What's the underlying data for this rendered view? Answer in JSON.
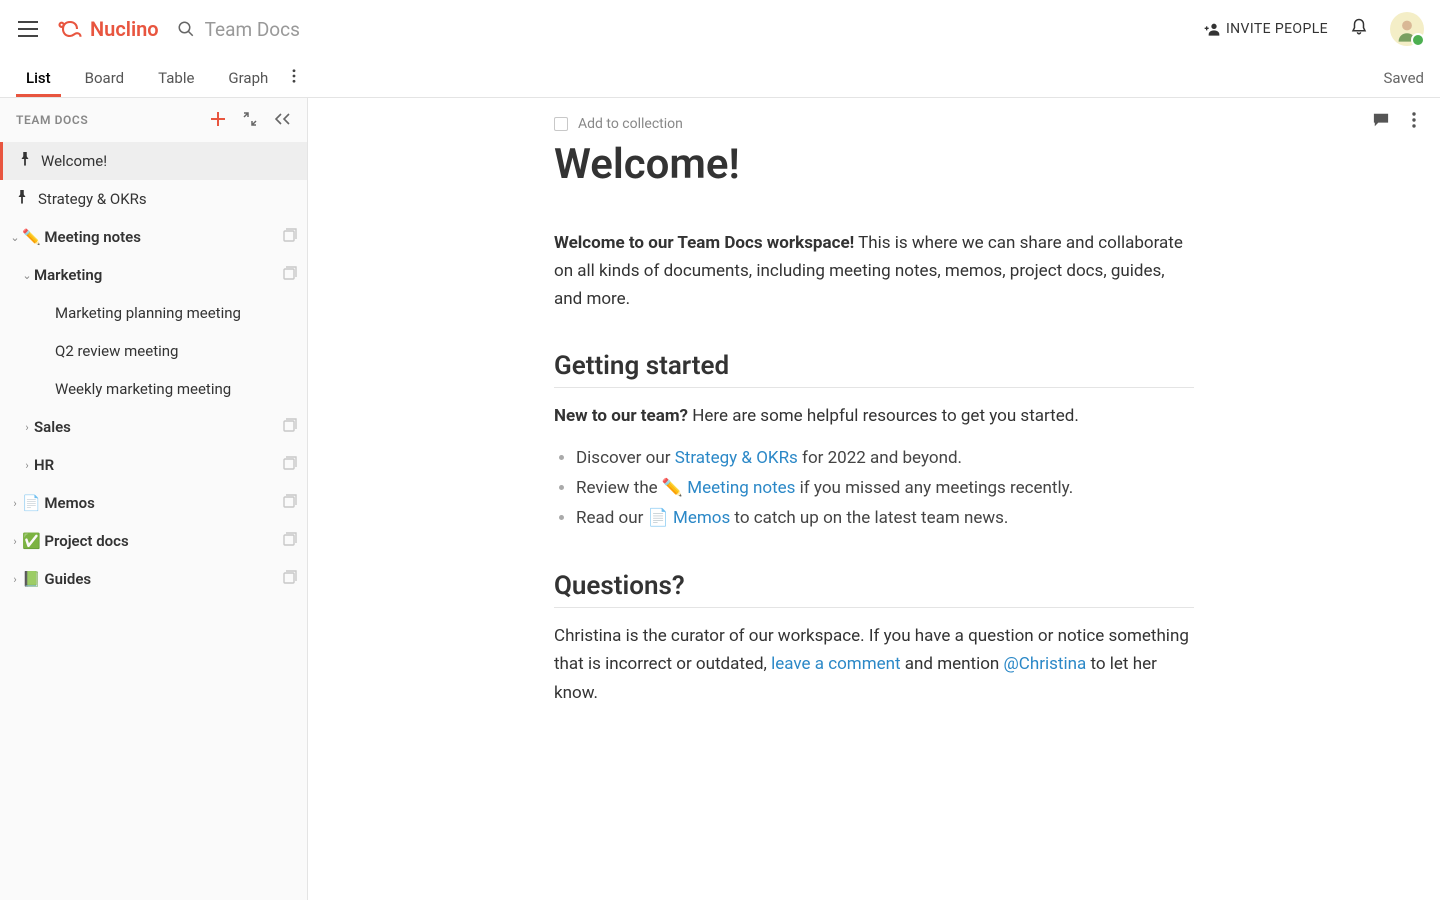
{
  "brand": "Nuclino",
  "search": {
    "placeholder": "Team Docs"
  },
  "invite_label": "INVITE PEOPLE",
  "tabs": {
    "list": "List",
    "board": "Board",
    "table": "Table",
    "graph": "Graph"
  },
  "saved_label": "Saved",
  "sidebar": {
    "title": "TEAM DOCS",
    "items": {
      "welcome": "Welcome!",
      "strategy": "Strategy & OKRs",
      "meeting_notes": "✏️ Meeting notes",
      "marketing": "Marketing",
      "mkt_planning": "Marketing planning meeting",
      "q2_review": "Q2 review meeting",
      "weekly_mkt": "Weekly marketing meeting",
      "sales": "Sales",
      "hr": "HR",
      "memos": "📄 Memos",
      "project_docs": "✅ Project docs",
      "guides": "📗 Guides"
    }
  },
  "doc": {
    "add_collection": "Add to collection",
    "title": "Welcome!",
    "intro_bold": "Welcome to our Team Docs workspace!",
    "intro_rest": " This is where we can share and collaborate on all kinds of documents, including meeting notes, memos, project docs, guides, and more.",
    "h2_getting": "Getting started",
    "new_bold": "New to our team?",
    "new_rest": " Here are some helpful resources to get you started.",
    "li1_a": "Discover our ",
    "li1_link": "Strategy & OKRs",
    "li1_b": " for 2022 and beyond.",
    "li2_a": "Review the ✏️ ",
    "li2_link": "Meeting notes",
    "li2_b": " if you missed any meetings recently.",
    "li3_a": "Read our 📄 ",
    "li3_link": "Memos",
    "li3_b": " to catch up on the latest team news.",
    "h2_questions": "Questions?",
    "q_a": "Christina is the curator of our workspace. If you have a question or notice something that is incorrect or outdated, ",
    "q_link1": "leave a comment",
    "q_b": " and mention ",
    "q_link2": "@Christina",
    "q_c": " to let her know."
  }
}
